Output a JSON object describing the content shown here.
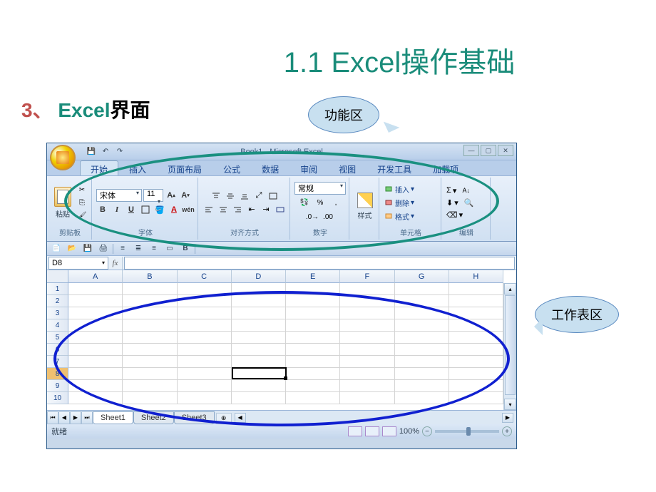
{
  "page": {
    "title": "1.1  Excel操作基础",
    "section_num": "3、",
    "section_teal": "Excel",
    "section_black": "界面"
  },
  "callouts": {
    "ribbon": "功能区",
    "sheet": "工作表区"
  },
  "excel": {
    "title": "Book1 - Microsoft Excel",
    "tabs": [
      "开始",
      "插入",
      "页面布局",
      "公式",
      "数据",
      "审阅",
      "视图",
      "开发工具",
      "加载项"
    ],
    "active_tab": "开始",
    "clipboard": {
      "paste": "粘贴",
      "label": "剪贴板"
    },
    "font": {
      "name": "宋体",
      "size": "11",
      "label": "字体",
      "b": "B",
      "i": "I",
      "u": "U",
      "a": "A",
      "wen": "wén"
    },
    "align": {
      "label": "对齐方式"
    },
    "number": {
      "format": "常规",
      "label": "数字"
    },
    "styles": {
      "btn": "样式"
    },
    "cells": {
      "insert": "插入",
      "delete": "删除",
      "format": "格式",
      "label": "单元格"
    },
    "editing": {
      "label": "编辑",
      "sigma": "Σ"
    },
    "namebox": "D8",
    "columns": [
      "A",
      "B",
      "C",
      "D",
      "E",
      "F",
      "G",
      "H"
    ],
    "rows": [
      "1",
      "2",
      "3",
      "4",
      "5",
      "6",
      "7",
      "8",
      "9",
      "10"
    ],
    "active_row": 8,
    "active_col": 3,
    "sheets": [
      "Sheet1",
      "Sheet2",
      "Sheet3"
    ],
    "active_sheet": "Sheet1",
    "status": "就绪",
    "zoom": "100%"
  }
}
